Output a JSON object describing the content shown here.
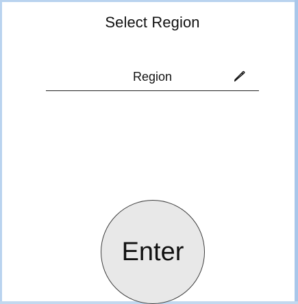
{
  "screen": {
    "title": "Select Region"
  },
  "region_field": {
    "placeholder": "Region",
    "value": "",
    "icon": "pencil-icon"
  },
  "enter_button": {
    "label": "Enter"
  },
  "colors": {
    "background": "#ffffff",
    "frame_edge": "#b9d3ef",
    "underline": "#222222",
    "button_fill": "#e8e8e8",
    "button_border": "#3b3b3b",
    "text": "#111111"
  }
}
